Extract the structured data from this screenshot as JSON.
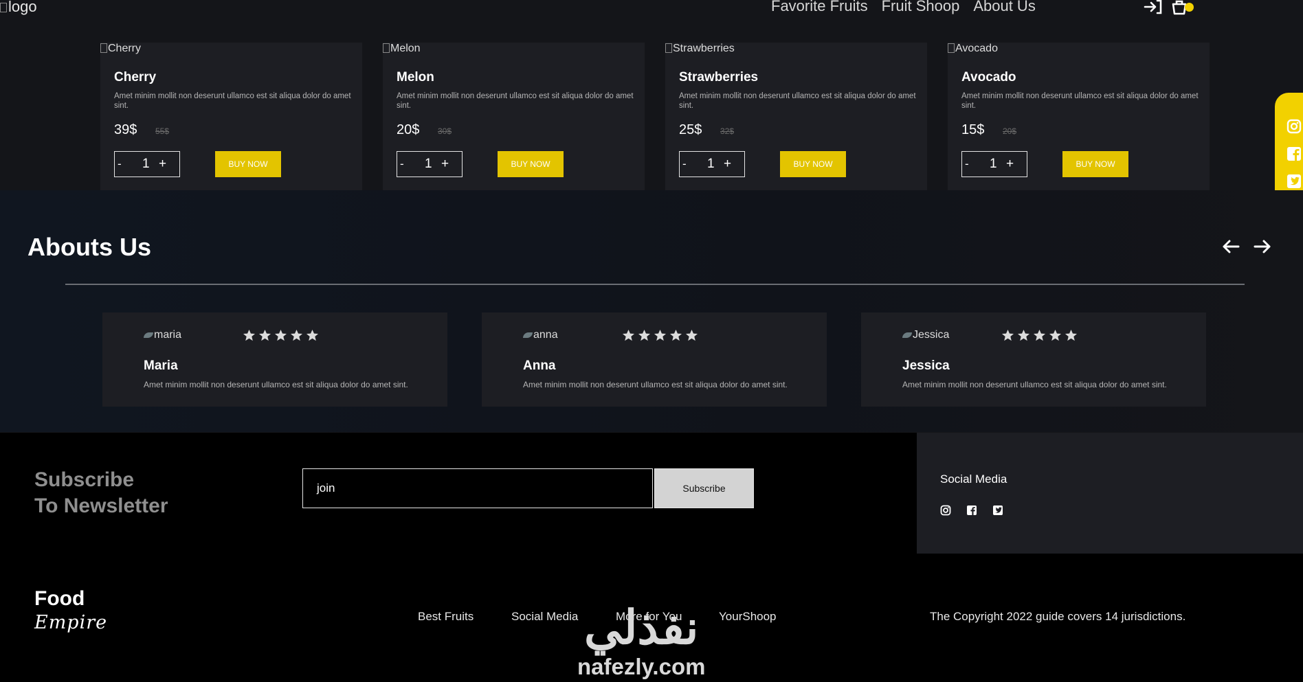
{
  "header": {
    "logo_alt": "logo",
    "nav": [
      "Favorite Fruits",
      "Fruit Shoop",
      "About Us"
    ],
    "icons": [
      "login-icon",
      "cart-icon"
    ]
  },
  "products": [
    {
      "img_alt": "Cherry",
      "name": "Cherry",
      "desc": "Amet minim mollit non deserunt ullamco est sit aliqua dolor do amet sint.",
      "price": "39$",
      "old_price": "55$",
      "qty": "1",
      "minus": "-",
      "plus": "+",
      "buy": "BUY NOW"
    },
    {
      "img_alt": "Melon",
      "name": "Melon",
      "desc": "Amet minim mollit non deserunt ullamco est sit aliqua dolor do amet sint.",
      "price": "20$",
      "old_price": "30$",
      "qty": "1",
      "minus": "-",
      "plus": "+",
      "buy": "BUY NOW"
    },
    {
      "img_alt": "Strawberries",
      "name": "Strawberries",
      "desc": "Amet minim mollit non deserunt ullamco est sit aliqua dolor do amet sint.",
      "price": "25$",
      "old_price": "32$",
      "qty": "1",
      "minus": "-",
      "plus": "+",
      "buy": "BUY NOW"
    },
    {
      "img_alt": "Avocado",
      "name": "Avocado",
      "desc": "Amet minim mollit non deserunt ullamco est sit aliqua dolor do amet sint.",
      "price": "15$",
      "old_price": "20$",
      "qty": "1",
      "minus": "-",
      "plus": "+",
      "buy": "BUY NOW"
    }
  ],
  "side_social": [
    "instagram-icon",
    "facebook-icon",
    "twitter-icon"
  ],
  "about": {
    "title": "Abouts Us",
    "reviews": [
      {
        "img_alt": "maria",
        "name": "Maria",
        "text": "Amet minim mollit non deserunt ullamco est sit aliqua dolor do amet sint.",
        "rating": 5
      },
      {
        "img_alt": "anna",
        "name": "Anna",
        "text": "Amet minim mollit non deserunt ullamco est sit aliqua dolor do amet sint.",
        "rating": 5
      },
      {
        "img_alt": "Jessica",
        "name": "Jessica",
        "text": "Amet minim mollit non deserunt ullamco est sit aliqua dolor do amet sint.",
        "rating": 5
      }
    ]
  },
  "footer": {
    "subscribe_line1": "Subscribe",
    "subscribe_line2": "To Newsletter",
    "input_value": "join",
    "subscribe_button": "Subscribe",
    "social_title": "Social Media",
    "brand_line1": "Food",
    "brand_line2": "Empire",
    "links": [
      "Best Fruits",
      "Social Media",
      "More for You",
      "YourShoop"
    ],
    "copyright": "The Copyright 2022 guide covers 14 jurisdictions."
  },
  "watermark": {
    "arabic": "نفذلي",
    "latin": "nafezly.com"
  },
  "colors": {
    "accent": "#e3c400",
    "background": "#141519",
    "card": "#1d1e23",
    "footer": "#000000"
  }
}
